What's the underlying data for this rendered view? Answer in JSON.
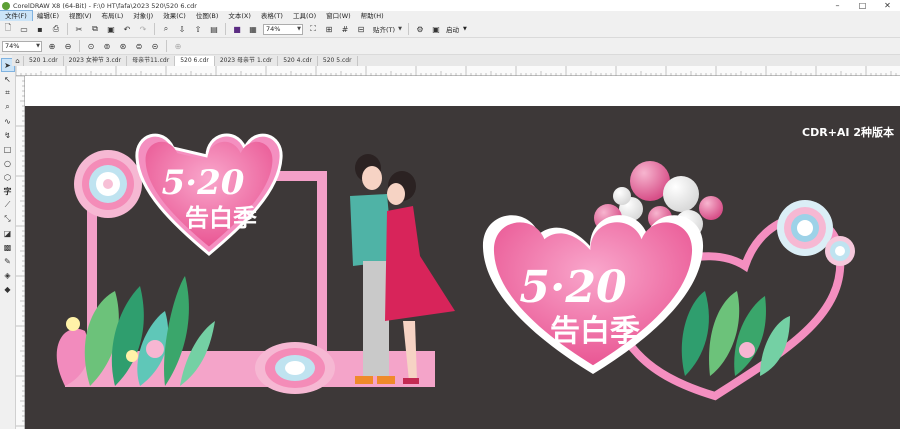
{
  "window": {
    "title": "CorelDRAW X8 (64-Bit) - F:\\0 HT\\fafa\\2023 520\\520 6.cdr"
  },
  "menu": [
    "文件(F)",
    "编辑(E)",
    "视图(V)",
    "布局(L)",
    "对象(J)",
    "效果(C)",
    "位图(B)",
    "文本(X)",
    "表格(T)",
    "工具(O)",
    "窗口(W)",
    "帮助(H)"
  ],
  "toolbar": {
    "zoom_value": "74%",
    "snap_label": "贴齐(T)",
    "launch_label": "启动"
  },
  "property_bar": {
    "zoom_value": "74%"
  },
  "tabs": [
    "520 1.cdr",
    "2023 女神节 3.cdr",
    "母亲节11.cdr",
    "520 6.cdr",
    "2023 母亲节 1.cdr",
    "520 4.cdr",
    "520 5.cdr"
  ],
  "active_tab": 3,
  "artwork": {
    "version_label": "CDR+AI 2种版本",
    "slogan_number_left": "5·20",
    "slogan_text_left": "告白季",
    "slogan_number_right": "5·20",
    "slogan_text_right": "告白季"
  },
  "colors": {
    "artboard": "#3d3838",
    "pink_frame": "#f28bbd",
    "heart_pink": "#ee6aa7",
    "accent_blue": "#5ab4d6"
  }
}
